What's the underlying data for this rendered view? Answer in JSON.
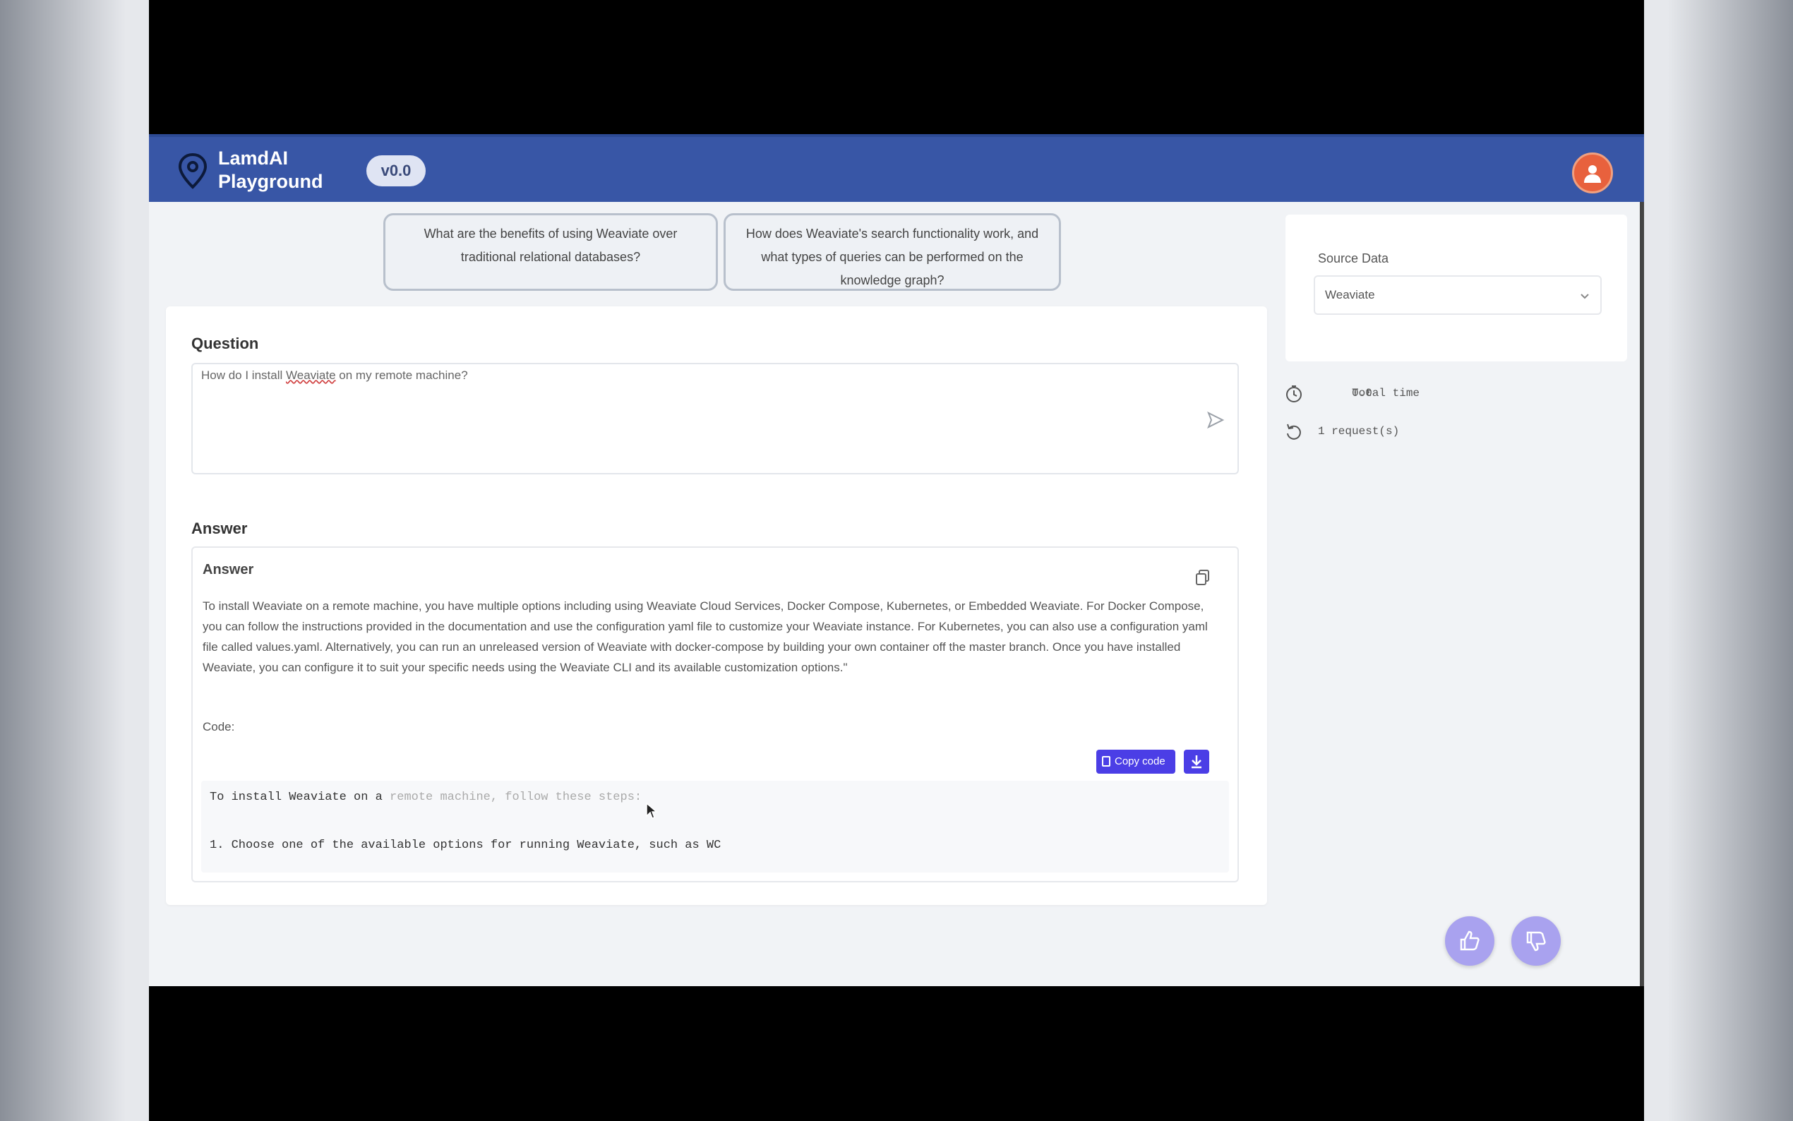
{
  "header": {
    "brand_line1": "LamdAI",
    "brand_line2": "Playground",
    "version": "v0.0"
  },
  "suggestions": [
    "What are the benefits of using Weaviate over traditional relational databases?",
    "How does Weaviate's search functionality work, and what types of queries can be performed on the knowledge graph?"
  ],
  "question": {
    "label": "Question",
    "text_before": "How do I install ",
    "text_underlined": "Weaviate",
    "text_after": " on my remote machine?"
  },
  "answer": {
    "section_label": "Answer",
    "card_title": "Answer",
    "body": "To install Weaviate on a remote machine, you have multiple options including using Weaviate Cloud Services, Docker Compose, Kubernetes, or Embedded Weaviate. For Docker Compose, you can follow the instructions provided in the documentation and use the configuration yaml file to customize your Weaviate instance. For Kubernetes, you can also use a configuration yaml file called values.yaml. Alternatively, you can run an unreleased version of Weaviate with docker-compose by building your own container off the master branch. Once you have installed Weaviate, you can configure it to suit your specific needs using the Weaviate CLI and its available customization options.\"",
    "code_label": "Code:",
    "copy_code_label": "Copy code",
    "code_line1_main": "To install Weaviate on a ",
    "code_line1_faint": "remote machine, follow these steps:",
    "code_line2": "1. Choose one of the available options for running Weaviate, such as WC"
  },
  "sidebar": {
    "source_label": "Source Data",
    "source_value": "Weaviate",
    "total_time_label": "Total time",
    "total_time_value": "0.0",
    "requests_text": "1 request(s)"
  },
  "colors": {
    "header": "#3856a6",
    "accent": "#4b3ee6",
    "avatar": "#e8613d",
    "fab": "#a9a2ef"
  }
}
